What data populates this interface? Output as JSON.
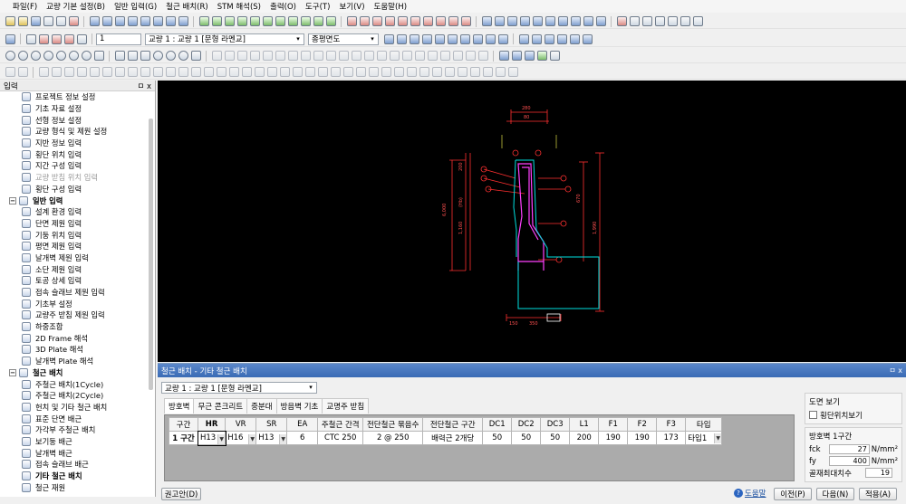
{
  "menu": [
    "파일(F)",
    "교량 기본 설정(B)",
    "일반 입력(G)",
    "철근 배치(R)",
    "STM 해석(S)",
    "출력(O)",
    "도구(T)",
    "보기(V)",
    "도움말(H)"
  ],
  "toolbar2": {
    "page_input": "1",
    "bridge_select": "교량 1 : 교량 1 [문형 라멘교]",
    "view_select": "종평면도"
  },
  "left_panel": {
    "title": "입력",
    "pin": "ㅁ x",
    "items": [
      {
        "label": "프로젝트 정보 설정",
        "level": 1,
        "dim": false
      },
      {
        "label": "기초 자료 설정",
        "level": 1,
        "dim": false
      },
      {
        "label": "선형 정보 설정",
        "level": 1,
        "dim": false
      },
      {
        "label": "교량 형식 및 제원 설정",
        "level": 1,
        "dim": false
      },
      {
        "label": "지반 정보 입력",
        "level": 1,
        "dim": false
      },
      {
        "label": "횡단 위치 입력",
        "level": 1,
        "dim": false
      },
      {
        "label": "지간 구성 입력",
        "level": 1,
        "dim": false
      },
      {
        "label": "교량 받침 위치 입력",
        "level": 1,
        "dim": true
      },
      {
        "label": "횡단 구성 입력",
        "level": 1,
        "dim": false
      },
      {
        "label": "일반 입력",
        "level": 0,
        "dim": false
      },
      {
        "label": "설계 환경 입력",
        "level": 1,
        "dim": false
      },
      {
        "label": "단면 제원 입력",
        "level": 1,
        "dim": false
      },
      {
        "label": "기둥 위치 입력",
        "level": 1,
        "dim": false
      },
      {
        "label": "평면 제원 입력",
        "level": 1,
        "dim": false
      },
      {
        "label": "날개벽 제원 입력",
        "level": 1,
        "dim": false
      },
      {
        "label": "소단 제원 입력",
        "level": 1,
        "dim": false
      },
      {
        "label": "토공 상세 입력",
        "level": 1,
        "dim": false
      },
      {
        "label": "접속 슬래브 제원 입력",
        "level": 1,
        "dim": false
      },
      {
        "label": "기초부 설정",
        "level": 1,
        "dim": false
      },
      {
        "label": "교량주 받침 제원 입력",
        "level": 1,
        "dim": false
      },
      {
        "label": "하중조합",
        "level": 1,
        "dim": false
      },
      {
        "label": "2D Frame 해석",
        "level": 1,
        "dim": false
      },
      {
        "label": "3D Plate 해석",
        "level": 1,
        "dim": false
      },
      {
        "label": "날개벽 Plate 해석",
        "level": 1,
        "dim": false
      },
      {
        "label": "철근 배치",
        "level": 0,
        "dim": false
      },
      {
        "label": "주철근 배치(1Cycle)",
        "level": 1,
        "dim": false
      },
      {
        "label": "주철근 배치(2Cycle)",
        "level": 1,
        "dim": false
      },
      {
        "label": "헌치 및 기타 철근 배치",
        "level": 1,
        "dim": false
      },
      {
        "label": "표준 단면 배근",
        "level": 1,
        "dim": false
      },
      {
        "label": "가각부 주철근 배치",
        "level": 1,
        "dim": false
      },
      {
        "label": "보기둥 배근",
        "level": 1,
        "dim": false
      },
      {
        "label": "날개벽 배근",
        "level": 1,
        "dim": false
      },
      {
        "label": "접속 슬래브 배근",
        "level": 1,
        "dim": false
      },
      {
        "label": "기타 철근 배치",
        "level": 1,
        "dim": false,
        "bold": true
      },
      {
        "label": "철근 재원",
        "level": 1,
        "dim": false
      }
    ]
  },
  "drawing": {
    "dims_top": [
      "280",
      "80"
    ],
    "dims_left": [
      "200",
      "6,000",
      "1,160",
      "(Hb)"
    ],
    "dims_right": [
      "670",
      "1,990"
    ],
    "dims_bottom": [
      "150",
      "350"
    ]
  },
  "dialog": {
    "title": "철근 배치 - 기타 철근 배치",
    "controls": "ㅁ x",
    "bridge_select": "교량 1 : 교량 1 [문형 라멘교]",
    "tabs": [
      "방호벽",
      "무근 콘크리트",
      "중분대",
      "방음벽 기초",
      "교명주 받침"
    ],
    "columns": [
      "구간",
      "HR",
      "VR",
      "SR",
      "EA",
      "주철근 간격",
      "전단철근 묶음수",
      "전단철근 구간",
      "DC1",
      "DC2",
      "DC3",
      "L1",
      "F1",
      "F2",
      "F3",
      "타입"
    ],
    "rows": [
      {
        "section": "1 구간",
        "hr": "H13",
        "vr": "H16",
        "sr": "H13",
        "ea": "6",
        "main_gap": "CTC 250",
        "shear_count": "2 @ 250",
        "shear_range": "배력근 2개당",
        "dc1": "50",
        "dc2": "50",
        "dc3": "50",
        "l1": "200",
        "f1": "190",
        "f2": "190",
        "f3": "173",
        "type": "타입1"
      }
    ],
    "drawing_view": {
      "title": "도면 보기",
      "checkbox_label": "횡단위치보기"
    },
    "guard_wall": {
      "title": "방호벽 1구간",
      "fck_label": "fck",
      "fck_value": "27",
      "fck_unit": "N/mm²",
      "fy_label": "fy",
      "fy_value": "400",
      "fy_unit": "N/mm²",
      "agg_label": "골재최대치수",
      "agg_value": "19"
    },
    "buttons": {
      "recommend": "권고안(D)",
      "help": "도움말",
      "prev": "이전(P)",
      "next": "다음(N)",
      "apply": "적용(A)"
    }
  }
}
